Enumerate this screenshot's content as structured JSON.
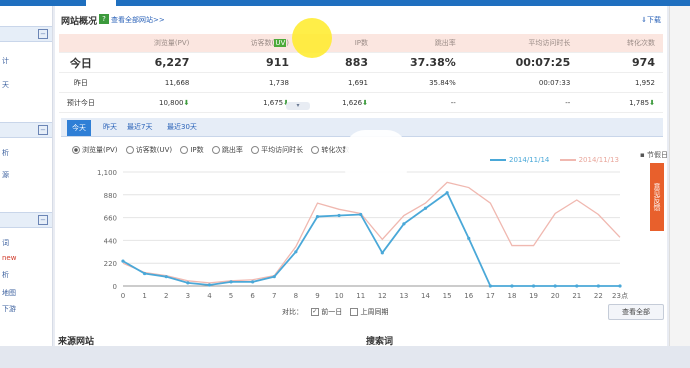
{
  "header": {
    "title": "网站概况",
    "viewall": "查看全部网站>>",
    "download": "下载"
  },
  "stats": {
    "headers": [
      "浏览量(PV)",
      "访客数(UV)",
      "IP数",
      "跳出率",
      "平均访问时长",
      "转化次数"
    ],
    "rows": [
      {
        "label": "今日",
        "values": [
          "6,227",
          "911",
          "883",
          "37.38%",
          "00:07:25",
          "974"
        ]
      },
      {
        "label": "昨日",
        "values": [
          "11,668",
          "1,738",
          "1,691",
          "35.84%",
          "00:07:33",
          "1,952"
        ]
      },
      {
        "label": "预计今日",
        "values": [
          "10,800",
          "1,675",
          "1,626",
          "--",
          "--",
          "1,785"
        ]
      }
    ]
  },
  "tabs": [
    "今天",
    "昨天",
    "最近7天",
    "最近30天"
  ],
  "metrics": [
    "浏览量(PV)",
    "访客数(UV)",
    "IP数",
    "跳出率",
    "平均访问时长",
    "转化次数"
  ],
  "holiday": "节假日",
  "feedback": "意见反馈",
  "compare": {
    "label": "对比：",
    "opt1": "前一日",
    "opt2": "上周同期"
  },
  "view_all_btn": "查看全部",
  "sidebar": {
    "items": [
      "计",
      "天",
      "析",
      "源",
      "词",
      "new",
      "析",
      "地图",
      "下游"
    ]
  },
  "bottom": {
    "left": "来源网站",
    "right": "搜索词"
  },
  "colors": {
    "blue": "#4aa8d8",
    "pink": "#f0b8b0",
    "accent": "#2f7fd6"
  },
  "chart_data": {
    "type": "line",
    "x": [
      0,
      1,
      2,
      3,
      4,
      5,
      6,
      7,
      8,
      9,
      10,
      11,
      12,
      13,
      14,
      15,
      16,
      17,
      18,
      19,
      20,
      21,
      22,
      23
    ],
    "xlabel_suffix": "23点",
    "ylim": [
      0,
      1100
    ],
    "yticks": [
      0,
      220,
      440,
      660,
      880,
      "1,100"
    ],
    "series": [
      {
        "name": "2014/11/14",
        "values": [
          240,
          120,
          90,
          30,
          10,
          40,
          40,
          90,
          330,
          670,
          680,
          690,
          320,
          600,
          750,
          900,
          460,
          0,
          0,
          0,
          0,
          0,
          0,
          0
        ]
      },
      {
        "name": "2014/11/13",
        "values": [
          220,
          130,
          100,
          50,
          30,
          50,
          60,
          100,
          380,
          800,
          740,
          700,
          450,
          680,
          800,
          1000,
          950,
          800,
          390,
          390,
          700,
          830,
          690,
          470
        ]
      }
    ]
  }
}
